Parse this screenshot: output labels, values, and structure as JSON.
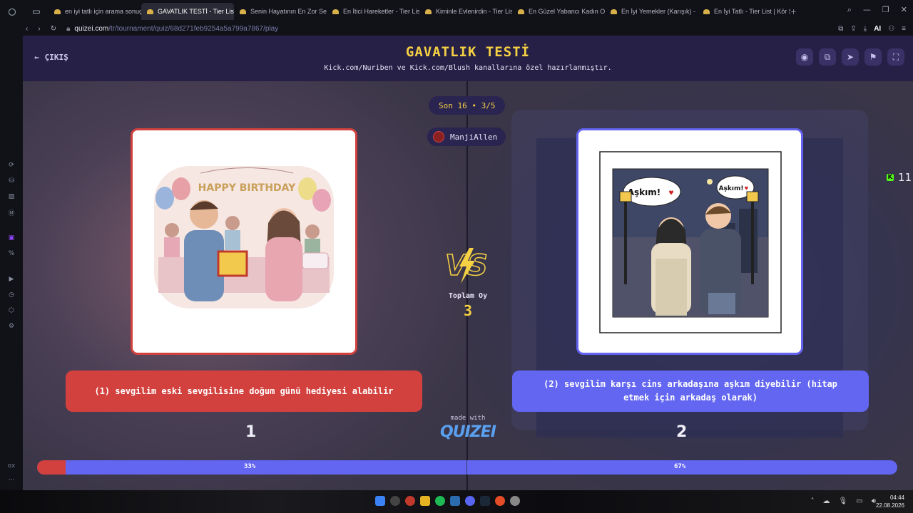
{
  "browser": {
    "tabs": [
      {
        "label": "en iyi tatlı için arama sonuç",
        "active": false
      },
      {
        "label": "GAVATLIK TESTİ - Tier List",
        "active": true
      },
      {
        "label": "Senin Hayatının En Zor Seç",
        "active": false
      },
      {
        "label": "En İtici Hareketler - Tier Lis",
        "active": false
      },
      {
        "label": "Kiminle Evlenirdin - Tier Lis",
        "active": false
      },
      {
        "label": "En Güzel Yabancı Kadın Oy",
        "active": false
      },
      {
        "label": "En İyi Yemekler (Karışık) - ",
        "active": false
      },
      {
        "label": "En İyi Tatlı - Tier List | Kör S",
        "active": false
      }
    ],
    "url_domain": "quizei.com",
    "url_path": "/tr/tournament/quiz/68d271feb9254a5a799a7867/play",
    "ai_label": "AI"
  },
  "header": {
    "exit_label": "ÇIKIŞ",
    "title": "GAVATLIK TESTİ",
    "subtitle": "Kick.com/Nuriben ve Kick.com/Blush kanallarına özel hazırlanmıştır."
  },
  "round": {
    "label": "Son 16 • 3/5",
    "user": "ManjiAllen"
  },
  "options": [
    {
      "number": "1",
      "text": "(1) sevgilim eski sevgilisine doğum günü hediyesi alabilir",
      "percent": 33,
      "percent_label": "33%",
      "banner_text": "HAPPY BIRTHDAY"
    },
    {
      "number": "2",
      "text": "(2) sevgilim karşı cins arkadaşına aşkım diyebilir (hitap etmek için arkadaş olarak)",
      "percent": 67,
      "percent_label": "67%",
      "bubble_left": "Aşkım!",
      "bubble_right": "Aşkım!"
    }
  ],
  "vs": {
    "total_label": "Toplam Oy",
    "total_value": "3",
    "made_with": "made with",
    "brand": "QUIZEI"
  },
  "viewers": {
    "count": "11"
  },
  "taskbar": {
    "time": "04:44",
    "date": "22.08.2026"
  },
  "colors": {
    "left_accent": "#d2413e",
    "right_accent": "#6366f1",
    "title_yellow": "#f5d143"
  }
}
